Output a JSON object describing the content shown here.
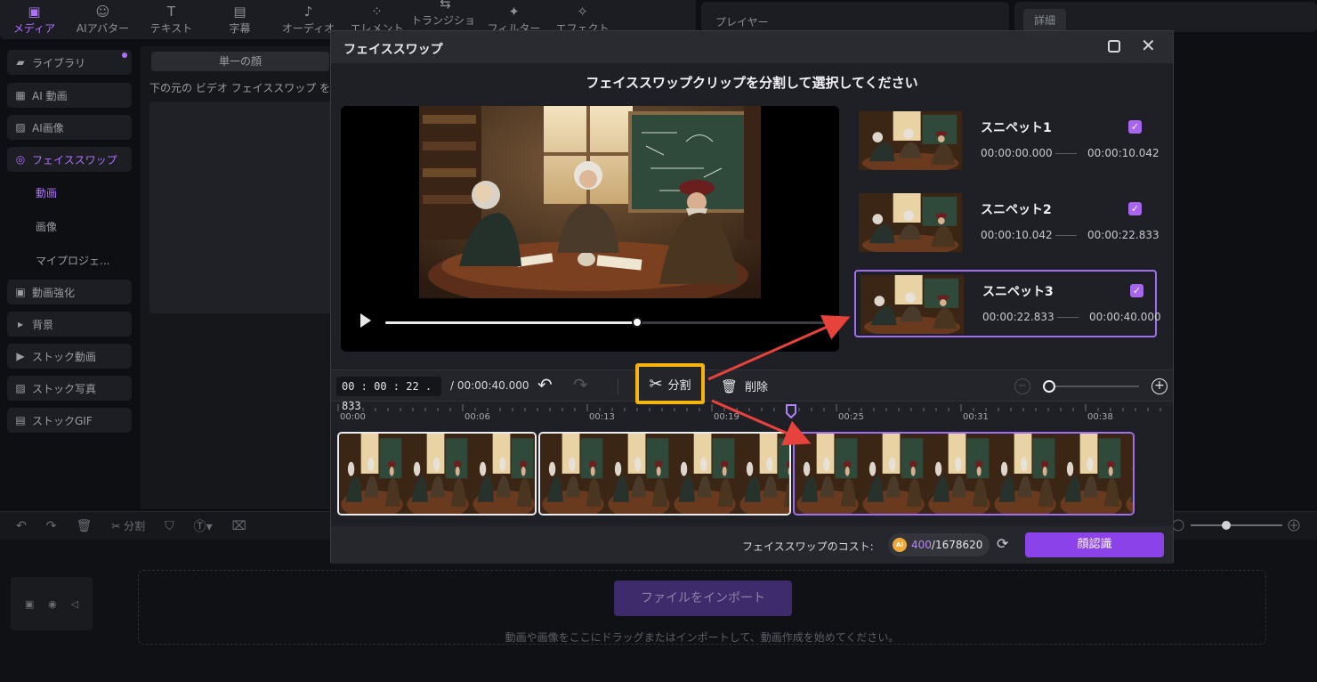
{
  "top_tabs": [
    {
      "label": "メディア",
      "icon": "media-icon",
      "glyph": "▣",
      "active": true
    },
    {
      "label": "AIアバター",
      "icon": "avatar-icon",
      "glyph": "☺",
      "active": false
    },
    {
      "label": "テキスト",
      "icon": "text-icon",
      "glyph": "T",
      "active": false
    },
    {
      "label": "字幕",
      "icon": "subtitle-icon",
      "glyph": "▤",
      "active": false
    },
    {
      "label": "オーディオ",
      "icon": "music-icon",
      "glyph": "♪",
      "active": false
    },
    {
      "label": "エレメント",
      "icon": "elements-icon",
      "glyph": "⁘",
      "active": false
    },
    {
      "label": "トランジション",
      "icon": "transition-icon",
      "glyph": "⇆",
      "active": false
    },
    {
      "label": "フィルター",
      "icon": "filter-icon",
      "glyph": "✦",
      "active": false
    },
    {
      "label": "エフェクト",
      "icon": "effect-icon",
      "glyph": "✧",
      "active": false
    }
  ],
  "player": {
    "label": "プレイヤー"
  },
  "details": {
    "label": "詳細"
  },
  "sidebar": {
    "items": [
      {
        "label": "ライブラリ",
        "icon": "folder-icon",
        "glyph": "▰"
      },
      {
        "label": "AI 動画",
        "icon": "ai-video-icon",
        "glyph": "▦"
      },
      {
        "label": "AI画像",
        "icon": "ai-image-icon",
        "glyph": "▨"
      },
      {
        "label": "フェイススワップ",
        "icon": "face-swap-icon",
        "glyph": "◎"
      },
      {
        "label": "動画"
      },
      {
        "label": "画像"
      },
      {
        "label": "マイプロジェ..."
      },
      {
        "label": "動画強化",
        "icon": "enhance-icon",
        "glyph": "▣"
      },
      {
        "label": "背景",
        "icon": "caret-right-icon",
        "glyph": "▸"
      },
      {
        "label": "ストック動画",
        "icon": "stock-video-icon",
        "glyph": "▶"
      },
      {
        "label": "ストック写真",
        "icon": "stock-photo-icon",
        "glyph": "▨"
      },
      {
        "label": "ストックGIF",
        "icon": "gif-icon",
        "glyph": "▤"
      }
    ]
  },
  "mid": {
    "single_face_tab": "単一の顔",
    "hint": "下の元の ビデオ フェイススワップ を"
  },
  "bottom": {
    "split_label": "分割",
    "import_label": "ファイルをインポート",
    "drop_hint": "動画や画像をここにドラッグまたはインポートして、動画作成を始めてください。"
  },
  "modal": {
    "title": "フェイススワップ",
    "heading": "フェイススワップクリップを分割して選択してください",
    "progress": 0.57,
    "snippets": [
      {
        "name": "スニペット1",
        "start": "00:00:00.000",
        "end": "00:00:10.042",
        "checked": true,
        "selected": false
      },
      {
        "name": "スニペット2",
        "start": "00:00:10.042",
        "end": "00:00:22.833",
        "checked": true,
        "selected": false
      },
      {
        "name": "スニペット3",
        "start": "00:00:22.833",
        "end": "00:00:40.000",
        "checked": true,
        "selected": true
      }
    ],
    "timecode": "00 : 00 : 22 . 833",
    "duration": "/ 00:00:40.000",
    "split_label": "分割",
    "delete_label": "削除",
    "ruler_labels": [
      "00:00",
      "00:06",
      "00:13",
      "00:19",
      "00:25",
      "00:31",
      "00:38"
    ],
    "playhead_time": 22.833,
    "clips": [
      {
        "start": 0,
        "end": 10.042,
        "selected": false
      },
      {
        "start": 10.042,
        "end": 22.833,
        "selected": false
      },
      {
        "start": 22.833,
        "end": 40,
        "selected": true
      }
    ],
    "cost_label": "フェイススワップのコスト:",
    "coin_label": "AI",
    "cost_used": "400",
    "cost_total": "/1678620",
    "face_button": "顔認識"
  },
  "colors": {
    "accent": "#a06ef0",
    "split_highlight": "#f5b412",
    "arrow": "#e8423c"
  }
}
